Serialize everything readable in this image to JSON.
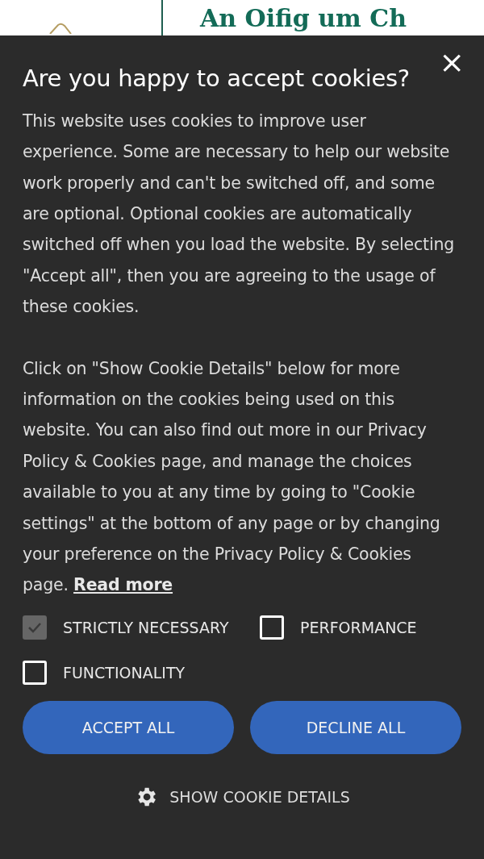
{
  "background_page": {
    "site_title": "An Oifig um Ch"
  },
  "cookie_dialog": {
    "close": "×",
    "title": "Are you happy to accept cookies?",
    "paragraphs": [
      {
        "text": "This website uses cookies to improve user experience. Some are necessary to help our website work properly and can't be switched off, and some are optional. Optional cookies are automatically switched off when you load the website. By selecting \"Accept all\", then you are agreeing to the usage of these cookies."
      },
      {
        "text": "Click on \"Show Cookie Details\" below for more information on the cookies being used on this website. You can also find out more in our Privacy Policy & Cookies page, and manage the choices available to you at any time by going to \"Cookie settings\" at the bottom of any page or by changing your preference on the Privacy Policy & Cookies page.",
        "link": "Read more"
      }
    ],
    "categories": [
      {
        "label": "STRICTLY NECESSARY",
        "checked": true,
        "disabled": true
      },
      {
        "label": "PERFORMANCE",
        "checked": false,
        "disabled": false
      },
      {
        "label": "FUNCTIONALITY",
        "checked": false,
        "disabled": false
      }
    ],
    "buttons": [
      "ACCEPT ALL",
      "DECLINE ALL"
    ],
    "details_link": "SHOW COOKIE DETAILS"
  }
}
